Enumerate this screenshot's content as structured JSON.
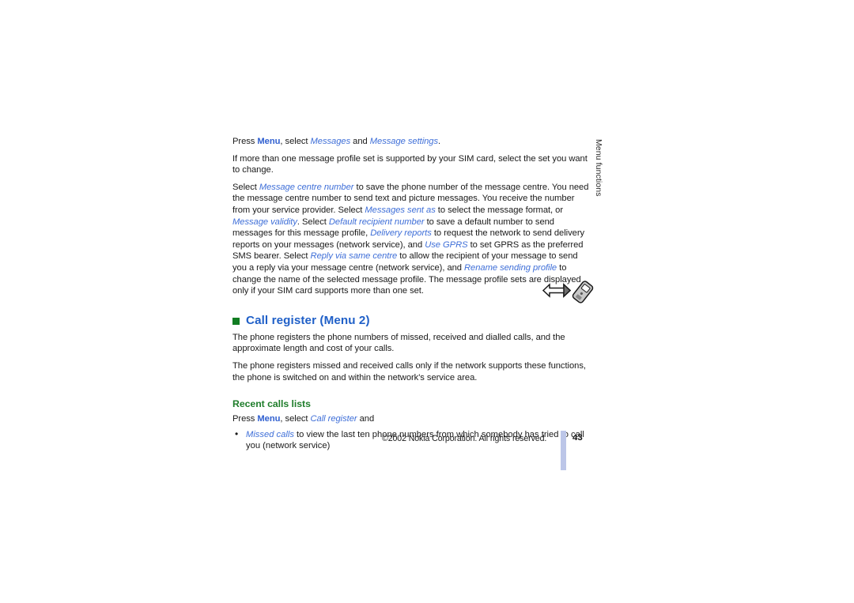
{
  "document": {
    "running_head": "Menu functions",
    "page_number": "43",
    "copyright": "©2002 Nokia Corporation. All rights reserved."
  },
  "message_settings": {
    "para1": {
      "pre": "Press ",
      "kw_menu": "Menu",
      "mid1": ", select ",
      "it_messages": "Messages",
      "mid2": " and ",
      "it_message_settings": "Message settings",
      "post": "."
    },
    "para2": "If more than one message profile set is supported by your SIM card, select the set you want to change.",
    "para3": {
      "t1": "Select ",
      "i1": "Message centre number",
      "t2": " to save the phone number of the message centre. You need the message centre number to send text and picture messages. You receive the number from your service provider. Select ",
      "i2": "Messages sent as",
      "t3": " to select the message format, or ",
      "i3": "Message validity",
      "t4": ". Select ",
      "i4": "Default recipient number",
      "t5": " to save a default number to send messages for this message profile, ",
      "i5": "Delivery reports",
      "t6": " to request the network to send delivery reports on your messages (network service), and ",
      "i6": "Use GPRS",
      "t7": " to set GPRS as the preferred SMS bearer. Select ",
      "i7": "Reply via same centre",
      "t8": " to allow the recipient of your message to send you a reply via your message centre (network service), and ",
      "i8": "Rename sending profile",
      "t9": " to change the name of the selected message profile. The message profile sets are displayed only if your SIM card supports more than one set."
    }
  },
  "call_register": {
    "heading": "Call register (Menu 2)",
    "bullet_color": "#117d22",
    "heading_color": "#2060c8",
    "para1": "The phone registers the phone numbers of missed, received and dialled calls, and the approximate length and cost of your calls.",
    "para2": "The phone registers missed and received calls only if the network supports these functions, the phone is switched on and within the network's service area.",
    "subheading": "Recent calls lists",
    "subheading_color": "#1f7d2b",
    "press_line": {
      "pre": "Press ",
      "kw_menu": "Menu",
      "mid": ", select ",
      "it_call_register": "Call register",
      "post": " and"
    },
    "bullets": [
      {
        "italic": "Missed calls",
        "text": " to view the last ten phone numbers from which somebody has tried to call you (network service)"
      }
    ]
  },
  "icons": {
    "margin_group": [
      "left-right-arrow-icon",
      "mobile-phone-icon"
    ]
  },
  "colors": {
    "link_blue": "#3f6fd8",
    "keyword_blue": "#2f5fd0",
    "green": "#1f7d2b",
    "page_bar": "#bcc6e8"
  }
}
